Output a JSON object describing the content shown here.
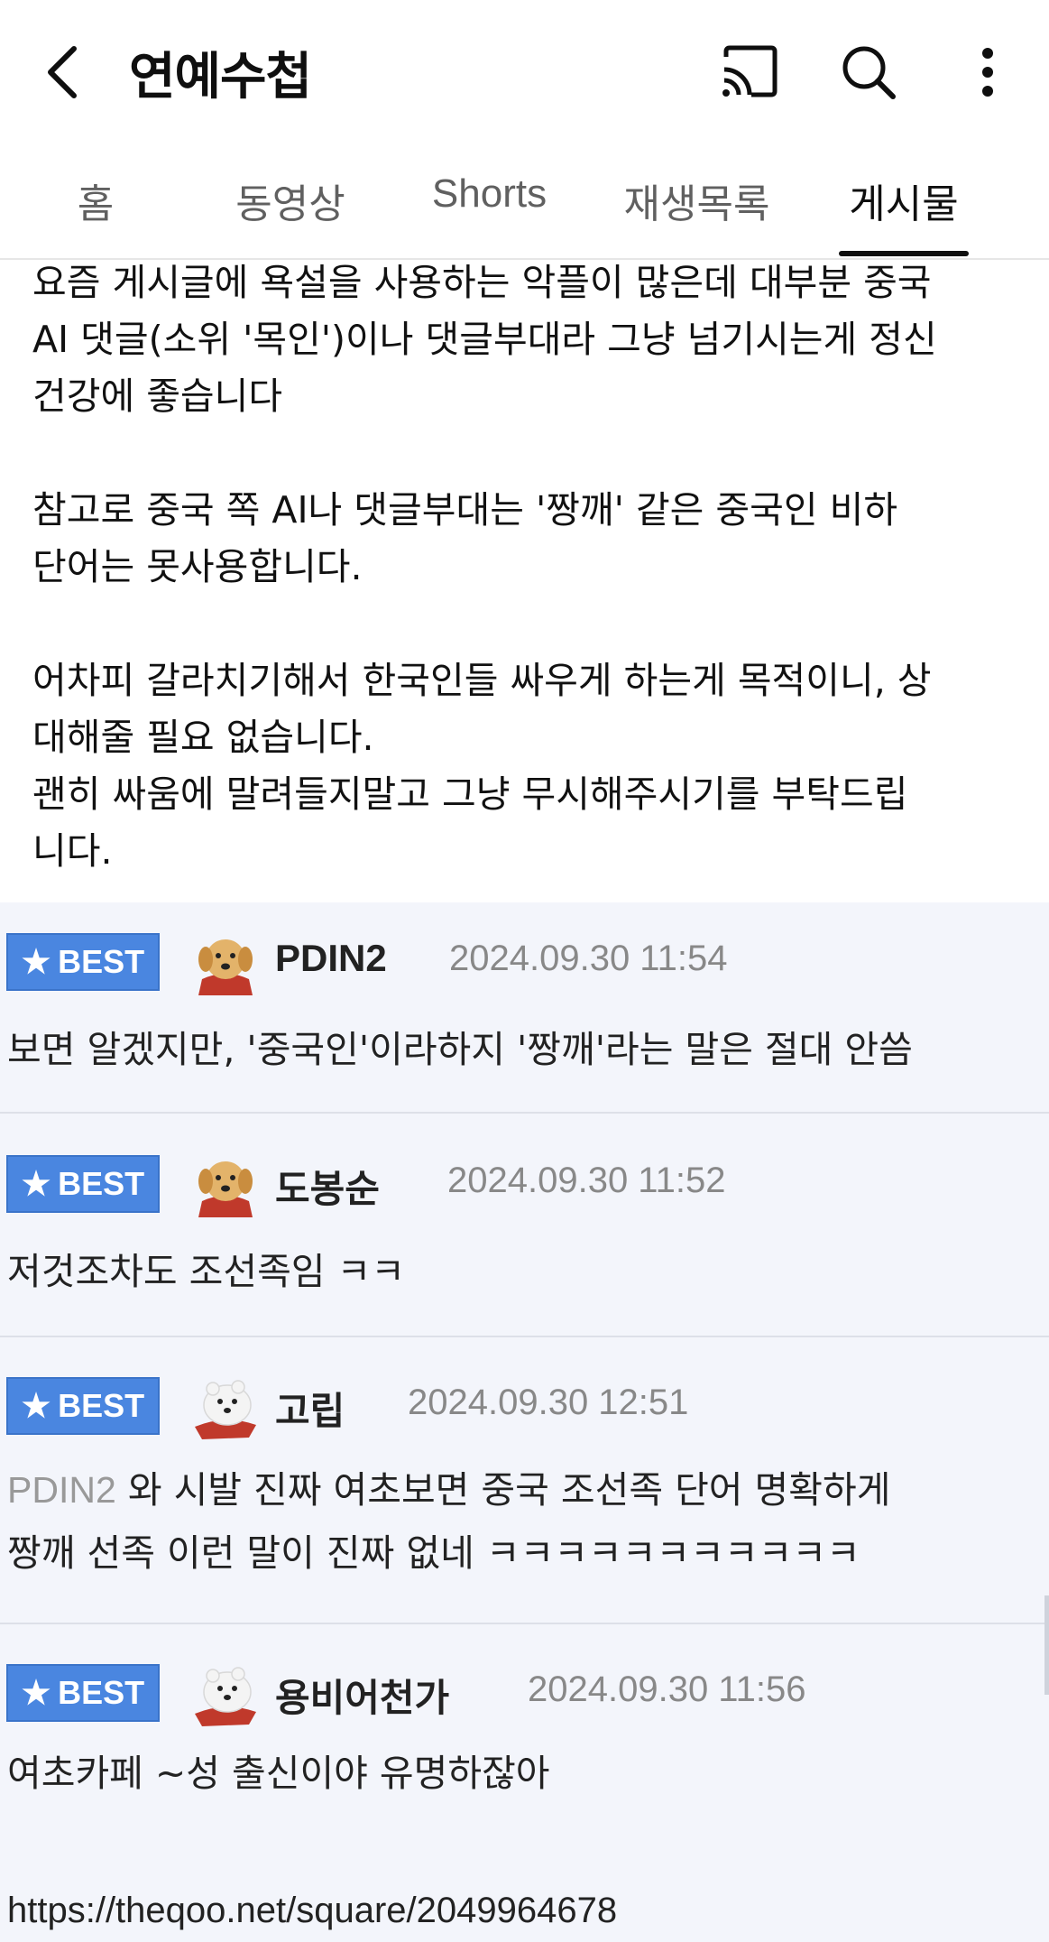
{
  "header": {
    "title": "연예수첩",
    "icons": [
      "back-arrow-icon",
      "cast-icon",
      "search-icon",
      "more-vert-icon"
    ]
  },
  "tabs": [
    {
      "label": "홈",
      "active": false
    },
    {
      "label": "동영상",
      "active": false
    },
    {
      "label": "Shorts",
      "active": false
    },
    {
      "label": "재생목록",
      "active": false
    },
    {
      "label": "게시물",
      "active": true
    }
  ],
  "post": {
    "paragraphs": [
      [
        "요즘 게시글에 욕설을 사용하는 악플이 많은데 대부분 중국",
        "AI 댓글(소위 '목인')이나 댓글부대라 그냥 넘기시는게 정신",
        "건강에 좋습니다"
      ],
      [
        "참고로 중국 쪽 AI나 댓글부대는 '짱깨' 같은 중국인 비하",
        "단어는 못사용합니다."
      ],
      [
        "어차피 갈라치기해서 한국인들 싸우게 하는게 목적이니, 상",
        "대해줄 필요 없습니다.",
        "괜히 싸움에 말려들지말고 그냥 무시해주시기를 부탁드립",
        "니다."
      ]
    ]
  },
  "comments": [
    {
      "badge": "BEST",
      "nick": "PDIN2",
      "date": "2024.09.30 11:54",
      "avatar": "puppy-avatar-icon",
      "mention": "",
      "lines": [
        "보면 알겠지만, '중국인'이라하지 '짱깨'라는 말은 절대 안씀"
      ]
    },
    {
      "badge": "BEST",
      "nick": "도봉순",
      "date": "2024.09.30 11:52",
      "avatar": "puppy-avatar-icon",
      "mention": "",
      "lines": [
        "저것조차도 조선족임 ㅋㅋ"
      ]
    },
    {
      "badge": "BEST",
      "nick": "고립",
      "date": "2024.09.30 12:51",
      "avatar": "polar-bear-avatar-icon",
      "mention": "PDIN2",
      "lines": [
        "와 시발 진짜 여초보면 중국 조선족 단어 명확하게",
        "짱깨 선족 이런 말이 진짜 없네 ㅋㅋㅋㅋㅋㅋㅋㅋㅋㅋㅋ"
      ]
    },
    {
      "badge": "BEST",
      "nick": "용비어천가",
      "date": "2024.09.30 11:56",
      "avatar": "polar-bear-avatar-icon",
      "mention": "",
      "lines": [
        "여초카페 ~성 출신이야 유명하잖아"
      ]
    }
  ],
  "source_url": "https://theqoo.net/square/2049964678",
  "colors": {
    "best_badge": "#4a86e0",
    "comments_bg": "#f3f5fb",
    "tab_active": "#0f0f0f",
    "tab_inactive": "#606060"
  }
}
